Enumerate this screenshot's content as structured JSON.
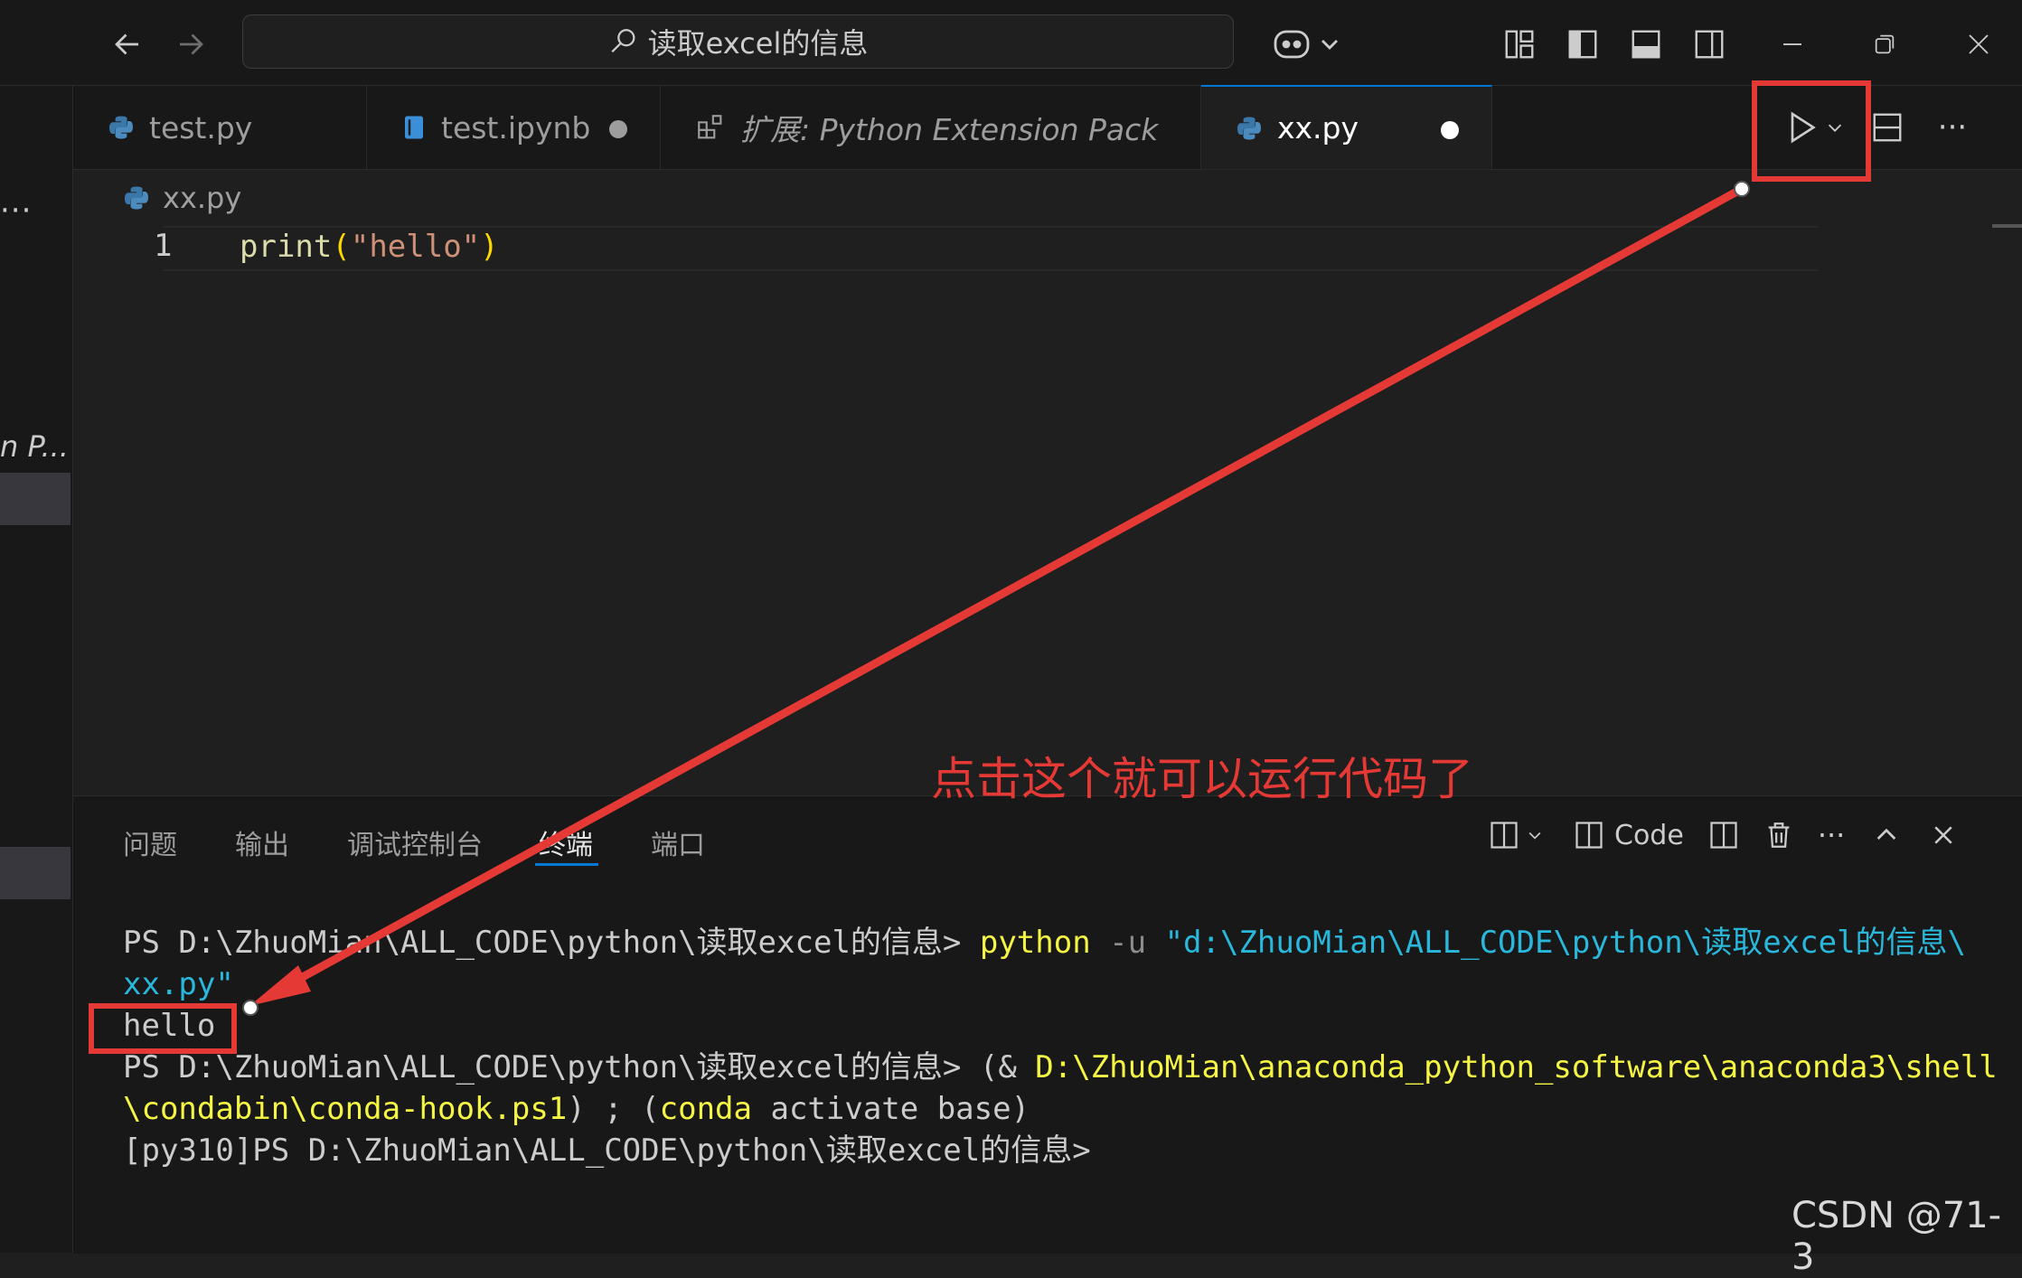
{
  "titlebar": {
    "search_text": "读取excel的信息"
  },
  "sidebar": {
    "overflow_label": "···",
    "truncated_text": "n P..."
  },
  "tabs": [
    {
      "label": "test.py",
      "icon": "python-icon",
      "active": false,
      "dirty": false
    },
    {
      "label": "test.ipynb",
      "icon": "notebook-icon",
      "active": false,
      "dirty": true
    },
    {
      "label": "扩展: Python Extension Pack",
      "icon": "extensions-icon",
      "active": false,
      "dirty": false
    },
    {
      "label": "xx.py",
      "icon": "python-icon",
      "active": true,
      "dirty": true
    }
  ],
  "breadcrumb": {
    "file": "xx.py"
  },
  "editor": {
    "line_number": "1",
    "code": {
      "fn": "print",
      "open": "(",
      "str": "\"hello\"",
      "close": ")"
    }
  },
  "annotation": {
    "text": "点击这个就可以运行代码了"
  },
  "panel": {
    "tabs": [
      "问题",
      "输出",
      "调试控制台",
      "终端",
      "端口"
    ],
    "active_tab": "终端",
    "profile_label": "Code"
  },
  "terminal": {
    "line1_prompt": "PS D:\\ZhuoMian\\ALL_CODE\\python\\读取excel的信息> ",
    "line1_cmd": "python",
    "line1_flag": " -u ",
    "line1_path": "\"d:\\ZhuoMian\\ALL_CODE\\python\\读取excel的信息\\",
    "line2_path": "xx.py\"",
    "line3_output": "hello",
    "line4_prompt": "PS D:\\ZhuoMian\\ALL_CODE\\python\\读取excel的信息> (& ",
    "line4_path": "D:\\ZhuoMian\\anaconda_python_software\\anaconda3\\shell",
    "line5_path": "\\condabin\\conda-hook.ps1",
    "line5_mid": ") ; (",
    "line5_cmd": "conda",
    "line5_rest": " activate base)",
    "line6": "[py310]PS D:\\ZhuoMian\\ALL_CODE\\python\\读取excel的信息>"
  },
  "watermark": "CSDN @71-3",
  "colors": {
    "accent": "#0078d4",
    "annotation_red": "#e53935",
    "terminal_yellow": "#f5f543",
    "terminal_cyan": "#29b8db"
  }
}
